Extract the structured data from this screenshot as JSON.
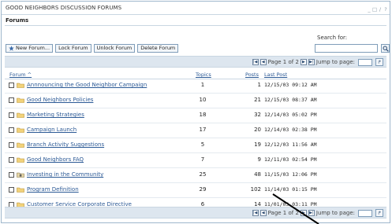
{
  "window": {
    "title": "GOOD NEIGHBORS DISCUSSION FORUMS",
    "controls": [
      "_",
      "□",
      "/",
      "?"
    ]
  },
  "section": {
    "heading": "Forums"
  },
  "search": {
    "label": "Search for:",
    "placeholder": ""
  },
  "toolbar": {
    "new_forum": "New Forum...",
    "lock_forum": "Lock Forum",
    "unlock_forum": "Unlock Forum",
    "delete_forum": "Delete Forum"
  },
  "pager_top": {
    "text": "Page 1 of 2",
    "jump_label": "Jump to page:"
  },
  "pager_bottom": {
    "text": "Page 1 of 2",
    "jump_label": "Jump to page:"
  },
  "columns": {
    "forum": "Forum ^",
    "topics": "Topics",
    "posts": "Posts",
    "last_post": "Last Post"
  },
  "forums": [
    {
      "name": "Annnouncing the Good Neighbor Campaign",
      "topics": "1",
      "posts": "1",
      "last_post": "12/15/03 09:12 AM",
      "icon": "folder-icon"
    },
    {
      "name": "Good Neighbors Policies",
      "topics": "10",
      "posts": "21",
      "last_post": "12/15/03 08:37 AM",
      "icon": "folder-icon"
    },
    {
      "name": "Marketing Strategies",
      "topics": "18",
      "posts": "32",
      "last_post": "12/14/03 05:02 PM",
      "icon": "folder-icon"
    },
    {
      "name": "Campaign Launch",
      "topics": "17",
      "posts": "20",
      "last_post": "12/14/03 02:38 PM",
      "icon": "folder-icon"
    },
    {
      "name": "Branch Activity Suggestions",
      "topics": "5",
      "posts": "19",
      "last_post": "12/12/03 11:56 AM",
      "icon": "folder-icon"
    },
    {
      "name": "Good Neighbors FAQ",
      "topics": "7",
      "posts": "9",
      "last_post": "12/11/03 02:54 PM",
      "icon": "folder-icon"
    },
    {
      "name": "Investing in the Community",
      "topics": "25",
      "posts": "48",
      "last_post": "11/15/03 12:06 PM",
      "icon": "locked-folder-icon"
    },
    {
      "name": "Program Definition",
      "topics": "29",
      "posts": "102",
      "last_post": "11/14/03 01:15 PM",
      "icon": "folder-icon"
    },
    {
      "name": "Customer Service Corporate Directive",
      "topics": "6",
      "posts": "14",
      "last_post": "11/01/03 03:11 PM",
      "icon": "folder-icon"
    }
  ],
  "colors": {
    "link": "#2c5a96",
    "pager_bg": "#dde6ef",
    "border": "#9fb7cc"
  }
}
